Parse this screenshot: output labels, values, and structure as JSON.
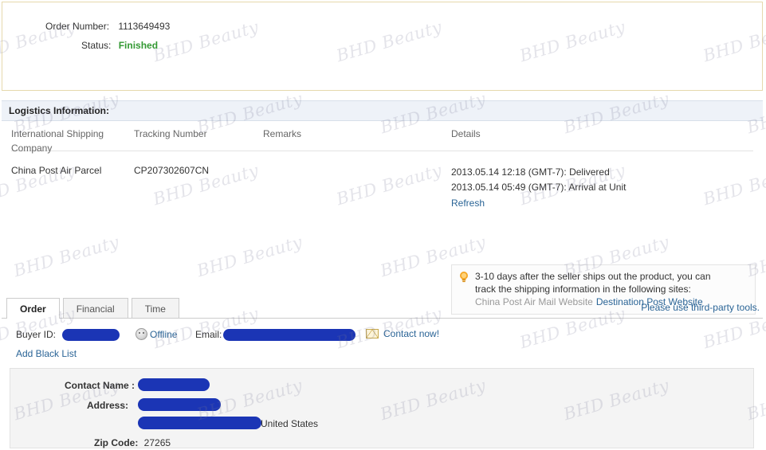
{
  "order_panel": {
    "order_number_label": "Order Number:",
    "order_number_value": "1113649493",
    "status_label": "Status:",
    "status_value": "Finished",
    "status_color": "#339933"
  },
  "logistics": {
    "header_title": "Logistics Information:",
    "columns": {
      "company": "International Shipping Company",
      "tracking": "Tracking Number",
      "remarks": "Remarks",
      "details": "Details"
    },
    "row": {
      "company": "China Post Air Parcel",
      "tracking": "CP207302607CN",
      "remarks": "",
      "details": [
        "2013.05.14 12:18 (GMT-7): Delivered",
        "2013.05.14 05:49 (GMT-7): Arrival at Unit"
      ],
      "refresh_label": "Refresh"
    },
    "tip": {
      "icon": "lightbulb-icon",
      "line1": "3-10 days after the seller ships out the product, you can",
      "line2": "track the shipping information in the following sites:",
      "link_china_post": "China Post Air Mail Website",
      "link_destination_post": "Destination Post Website"
    }
  },
  "tabs": {
    "items": [
      {
        "label": "Order",
        "active": true
      },
      {
        "label": "Financial",
        "active": false
      },
      {
        "label": "Time",
        "active": false
      }
    ],
    "third_party_note": "Please use third-party tools."
  },
  "buyer": {
    "buyer_id_label": "Buyer ID:",
    "buyer_id_value": "",
    "offline_label": "Offline",
    "offline_icon": "offline-face-icon",
    "email_label": "Email:",
    "email_value": "",
    "contact_now_label": "Contact now!",
    "contact_icon": "envelope-icon",
    "add_black_list_label": "Add Black List"
  },
  "address": {
    "contact_name_label": "Contact Name :",
    "contact_name_value": "",
    "address_label": "Address:",
    "address_line1": "",
    "address_line2": "",
    "country": "United States",
    "zip_label": "Zip Code:",
    "zip_value": "27265"
  },
  "watermark": {
    "text": "BHD Beauty",
    "short_text": "BHD"
  },
  "colors": {
    "link": "#2a6496",
    "status_green": "#339933",
    "redaction": "#1b35b5",
    "panel_border": "#e6d9ac",
    "logistics_header_bg": "#eef2f8"
  }
}
